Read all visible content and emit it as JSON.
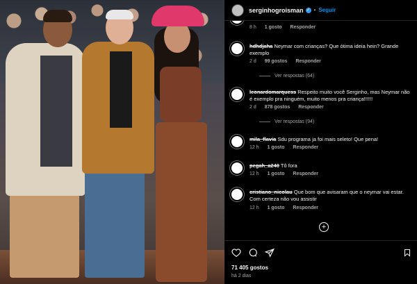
{
  "header": {
    "username": "serginhogroisman",
    "verified_mark": "✓",
    "separator": "•",
    "follow_label": "Seguir"
  },
  "comments": [
    {
      "meta_time": "8 h",
      "meta_likes": "1 gosto",
      "meta_reply": "Responder"
    },
    {
      "user": "hdhdjaha",
      "text": "Neymar com crianças? Que ótima ideia hein? Grande exemplo",
      "meta_time": "2 d",
      "meta_likes": "99 gostos",
      "meta_reply": "Responder",
      "replies": "Ver respostas (64)"
    },
    {
      "user": "leonardomarquess",
      "text": "Respeito muito você Serginho, mas Neymar não é exemplo pra ninguém, muito menos pra criança!!!!!!",
      "meta_time": "2 d",
      "meta_likes": "878 gostos",
      "meta_reply": "Responder",
      "replies": "Ver respostas (94)"
    },
    {
      "user": "mila_flavia",
      "text": "Sdu programa ja foi mais seleto! Que pena!",
      "meta_time": "12 h",
      "meta_likes": "1 gosto",
      "meta_reply": "Responder"
    },
    {
      "user": "pegah_a240",
      "text": "Tô fora",
      "meta_time": "12 h",
      "meta_likes": "1 gosto",
      "meta_reply": "Responder"
    },
    {
      "user": "cristiano_nicolau",
      "text": "Que bom que avisaram que o neymar vai estar. Com certeza não vou assistir",
      "meta_time": "12 h",
      "meta_likes": "1 gosto",
      "meta_reply": "Responder"
    }
  ],
  "load_more": "+",
  "footer": {
    "likes": "71 405 gostos",
    "time": "há 2 dias"
  },
  "icons": [
    "heart-icon",
    "comment-icon",
    "share-icon",
    "bookmark-icon",
    "add-circle-icon"
  ],
  "colors": {
    "accent": "#0095f6",
    "background": "#000000",
    "muted": "#a8a8a8"
  }
}
